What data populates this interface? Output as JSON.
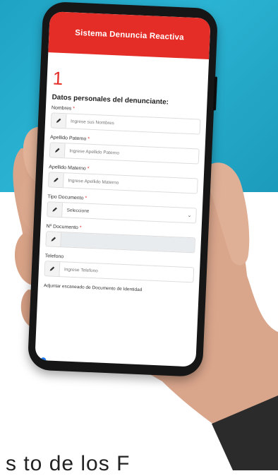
{
  "app": {
    "title": "Sistema Denuncia Reactiva",
    "step_number": "1",
    "section_title": "Datos personales del denunciante:",
    "required_mark": "*"
  },
  "form": {
    "fields": [
      {
        "label": "Nombres",
        "required": true,
        "placeholder": "Ingrese sus Nombres",
        "icon": "pencil-icon"
      },
      {
        "label": "Apellido Paterno",
        "required": true,
        "placeholder": "Ingrese Apellido Paterno",
        "icon": "pencil-icon"
      },
      {
        "label": "Apellido Materno",
        "required": true,
        "placeholder": "Ingrese Apellido Materno",
        "icon": "pencil-icon"
      },
      {
        "label": "Tipo Documento",
        "required": true,
        "value": "Seleccione",
        "icon": "pencil-icon"
      },
      {
        "label": "Nº Documento",
        "required": true,
        "placeholder": "",
        "icon": "pencil-icon",
        "disabled": true
      },
      {
        "label": "Telefono",
        "required": false,
        "placeholder": "Ingrese Telefono",
        "icon": "pencil-icon"
      }
    ],
    "attachment_label": "Adjuntar escaneado de Documento de Identidad"
  },
  "page_text": {
    "bottom_partial": "s to de los F"
  },
  "colors": {
    "brand_red": "#e52d27",
    "background_cyan": "#1fa3c4"
  }
}
